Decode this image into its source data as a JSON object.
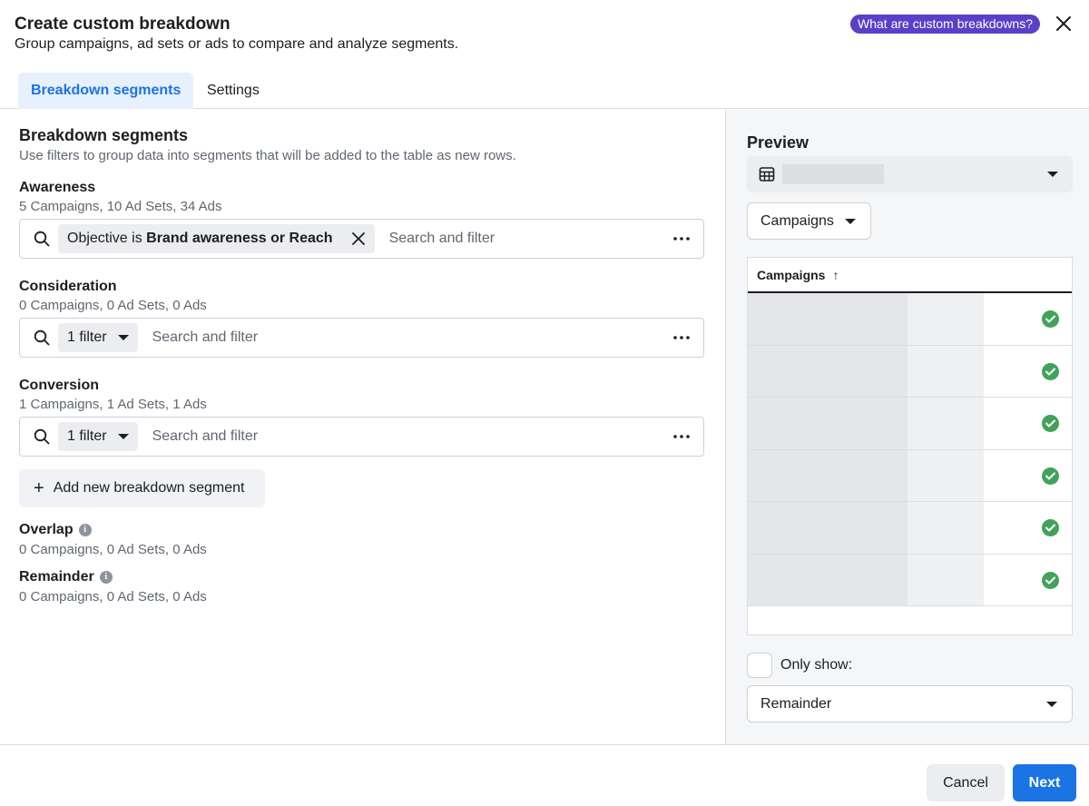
{
  "header": {
    "title": "Create custom breakdown",
    "subtitle": "Group campaigns, ad sets or ads to compare and analyze segments.",
    "help_link": "What are custom breakdowns?",
    "close_icon": "close-icon"
  },
  "tabs": [
    {
      "label": "Breakdown segments",
      "active": true
    },
    {
      "label": "Settings",
      "active": false
    }
  ],
  "main": {
    "title": "Breakdown segments",
    "description": "Use filters to group data into segments that will be added to the table as new rows.",
    "segments": [
      {
        "name": "Awareness",
        "counts": "5 Campaigns, 10 Ad Sets, 34 Ads",
        "chip_prefix": "Objective is ",
        "chip_value": "Brand awareness or Reach",
        "placeholder": "Search and filter"
      },
      {
        "name": "Consideration",
        "counts": "0 Campaigns, 0 Ad Sets, 0 Ads",
        "chip_label": "1 filter",
        "placeholder": "Search and filter"
      },
      {
        "name": "Conversion",
        "counts": "1 Campaigns, 1 Ad Sets, 1 Ads",
        "chip_label": "1 filter",
        "placeholder": "Search and filter"
      }
    ],
    "add_segment": "Add new breakdown segment",
    "overlap": {
      "name": "Overlap",
      "counts": "0 Campaigns, 0 Ad Sets, 0 Ads"
    },
    "remainder": {
      "name": "Remainder",
      "counts": "0 Campaigns, 0 Ad Sets, 0 Ads"
    }
  },
  "preview": {
    "title": "Preview",
    "level_select": "Campaigns",
    "table_header": "Campaigns",
    "sort_icon": "arrow-up-icon",
    "row_status_icon": "check-circle-icon",
    "row_count": 6,
    "only_show_label": "Only show:",
    "only_show_value": "Remainder"
  },
  "footer": {
    "cancel": "Cancel",
    "next": "Next"
  },
  "colors": {
    "accent": "#1b74e4",
    "help_pill": "#5a3fc8",
    "success": "#42a25a"
  }
}
